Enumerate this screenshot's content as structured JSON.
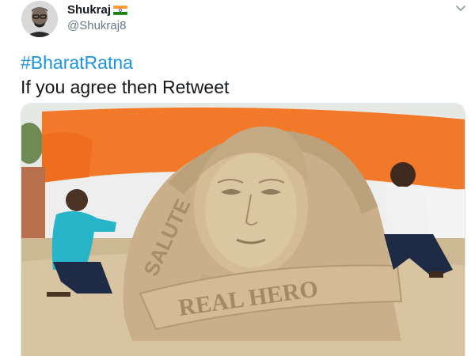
{
  "tweet": {
    "author": {
      "display_name": "Shukraj",
      "handle": "@Shukraj8",
      "avatar_icon": "person-avatar",
      "flag_icon": "india-flag-icon"
    },
    "menu_icon": "chevron-down-icon",
    "hashtag": "#BharatRatna",
    "text": "If you agree then Retweet",
    "media": {
      "kind": "photo",
      "sculpture_text_1": "SALUTE",
      "sculpture_text_2": "REAL HERO"
    }
  },
  "colors": {
    "hashtag": "#1b95e0",
    "text": "#14171a",
    "secondary": "#657786",
    "backdrop_orange": "#f2792a"
  }
}
